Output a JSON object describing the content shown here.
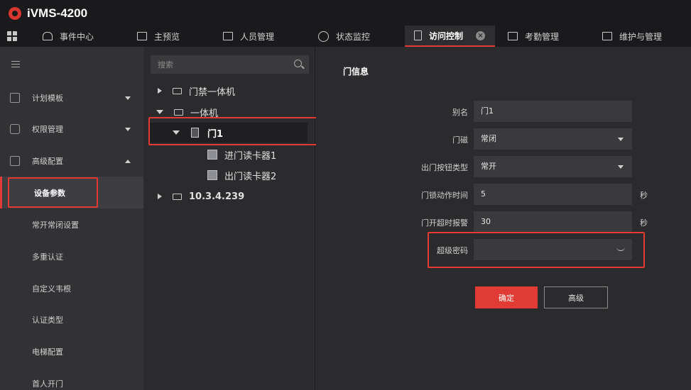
{
  "app": {
    "title": "iVMS-4200"
  },
  "tabs": [
    {
      "label": "事件中心",
      "icon": "alarm-bell-icon"
    },
    {
      "label": "主预览",
      "icon": "monitor-icon"
    },
    {
      "label": "人员管理",
      "icon": "person-card-icon"
    },
    {
      "label": "状态监控",
      "icon": "gauge-icon"
    },
    {
      "label": "访问控制",
      "icon": "door-icon",
      "active": true
    },
    {
      "label": "考勤管理",
      "icon": "calendar-icon"
    },
    {
      "label": "维护与管理",
      "icon": "maintenance-icon"
    }
  ],
  "sidebar": {
    "items": [
      {
        "label": "计划模板",
        "icon": "template-icon"
      },
      {
        "label": "权限管理",
        "icon": "lock-icon"
      },
      {
        "label": "高级配置",
        "icon": "settings-doc-icon",
        "expanded": true
      }
    ],
    "subitems": [
      {
        "label": "设备参数",
        "active": true
      },
      {
        "label": "常开常闭设置"
      },
      {
        "label": "多重认证"
      },
      {
        "label": "自定义韦根"
      },
      {
        "label": "认证类型"
      },
      {
        "label": "电梯配置"
      },
      {
        "label": "首人开门"
      }
    ]
  },
  "tree": {
    "search_placeholder": "搜索",
    "nodes": [
      {
        "label": "门禁一体机"
      },
      {
        "label": "一体机"
      },
      {
        "label": "门1"
      },
      {
        "label": "进门读卡器1"
      },
      {
        "label": "出门读卡器2"
      },
      {
        "label": "10.3.4.239"
      }
    ]
  },
  "form": {
    "title": "门信息",
    "fields": [
      {
        "label": "别名",
        "value": "门1"
      },
      {
        "label": "门磁",
        "value": "常闭"
      },
      {
        "label": "出门按钮类型",
        "value": "常开"
      },
      {
        "label": "门锁动作时间",
        "value": "5",
        "unit": "秒"
      },
      {
        "label": "门开超时报警",
        "value": "30",
        "unit": "秒"
      },
      {
        "label": "超级密码",
        "value": ""
      }
    ],
    "ok_label": "确定",
    "advanced_label": "高级"
  },
  "colors": {
    "accent": "#e03c35",
    "highlight_border": "#e23a32",
    "background": "#2b2b2e",
    "sidebar": "#323235",
    "topbar": "#1a1a1c"
  }
}
